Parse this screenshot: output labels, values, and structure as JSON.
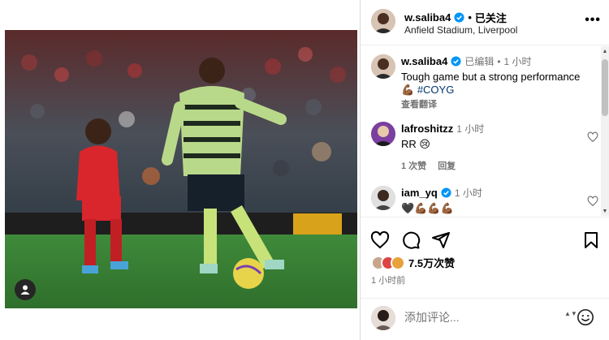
{
  "post": {
    "username": "w.saliba4",
    "follow_status": "已关注",
    "location": "Anfield Stadium, Liverpool",
    "more_label": "•••"
  },
  "caption": {
    "username": "w.saliba4",
    "edited": "已编辑",
    "time": "1 小时",
    "text": "Tough game but a strong performance 💪🏾",
    "hashtag": "#COYG",
    "translate": "查看翻译"
  },
  "comments": [
    {
      "username": "lafroshitzz",
      "time": "1 小时",
      "text": "RR 😢",
      "likes": "1 次赞",
      "reply": "回复"
    },
    {
      "username": "iam_yq",
      "time": "1 小时",
      "text": "🖤💪🏾💪🏾💪🏾"
    }
  ],
  "actions": {
    "likes": "7.5万次赞",
    "posted": "1 小时前"
  },
  "composer": {
    "placeholder": "添加评论...",
    "stepper": "▲▼"
  },
  "colors": {
    "verified": "#0095f6",
    "link": "#00376b",
    "meta": "#737373"
  },
  "icons": [
    "tag-user-icon",
    "verified-badge-icon",
    "more-options-icon",
    "heart-icon",
    "comment-icon",
    "share-icon",
    "bookmark-icon",
    "emoji-icon"
  ]
}
